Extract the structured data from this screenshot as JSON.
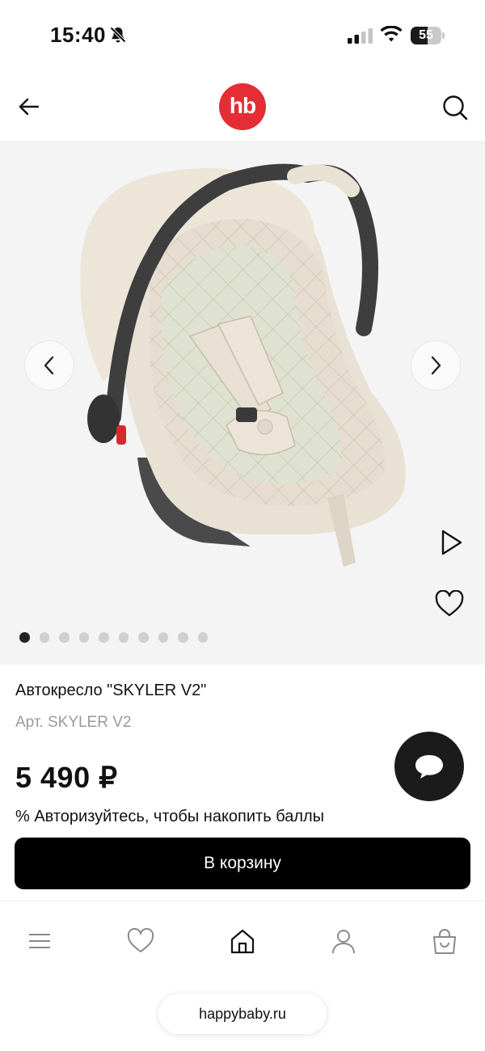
{
  "status_bar": {
    "time": "15:40",
    "battery_percent": "55",
    "battery_level": 0.55
  },
  "header": {
    "logo_text": "hb",
    "brand_color": "#e52d36"
  },
  "gallery": {
    "image_count": 10,
    "active_index": 0
  },
  "product": {
    "title": "Автокресло \"SKYLER V2\"",
    "article": "Арт. SKYLER V2",
    "price": "5 490 ₽",
    "points_text": "% Авторизуйтесь, чтобы накопить баллы",
    "add_to_cart_label": "В корзину"
  },
  "icons": {
    "back": "arrow-left-icon",
    "search": "search-icon",
    "prev": "chevron-left-icon",
    "next": "chevron-right-icon",
    "play": "play-icon",
    "favorite": "heart-icon",
    "chat": "chat-bubble-icon",
    "menu": "menu-icon",
    "home": "home-icon",
    "profile": "profile-icon",
    "bag": "shopping-bag-icon"
  },
  "browser": {
    "url": "happybaby.ru"
  }
}
